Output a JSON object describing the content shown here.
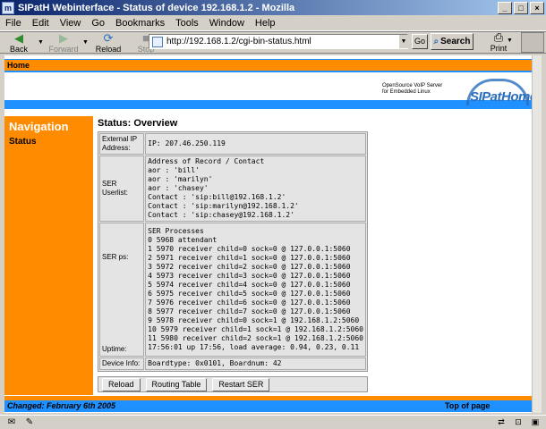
{
  "window": {
    "title": "SIPatH Webinterface - Status of device 192.168.1.2 - Mozilla",
    "icon": "mozilla-icon"
  },
  "menu": [
    "File",
    "Edit",
    "View",
    "Go",
    "Bookmarks",
    "Tools",
    "Window",
    "Help"
  ],
  "toolbar": {
    "back": "Back",
    "forward": "Forward",
    "reload": "Reload",
    "stop": "Stop",
    "url": "http://192.168.1.2/cgi-bin-status.html",
    "go": "Go",
    "search": "Search",
    "print": "Print"
  },
  "page": {
    "home_link": "Home",
    "tagline": [
      "OpenSource VoIP Server",
      "for Embedded Linux"
    ],
    "logo_text": "SIPatHome",
    "nav_title": "Navigation",
    "nav_items": [
      "Status"
    ],
    "heading": "Status: Overview",
    "rows": {
      "external_ip": {
        "label": "External IP Address:",
        "lines": [
          "IP: 207.46.250.119"
        ]
      },
      "ser_userlist": {
        "label": "SER Userlist:",
        "lines": [
          "Address of Record / Contact",
          "aor : 'bill'",
          "aor : 'marilyn'",
          "aor : 'chasey'",
          "Contact : 'sip:bill@192.168.1.2'",
          "Contact : 'sip:marilyn@192.168.1.2'",
          "Contact : 'sip:chasey@192.168.1.2'"
        ]
      },
      "ser_ps": {
        "label": "SER ps:",
        "uptime_label": "Uptime:",
        "lines": [
          "SER Processes",
          "0 5968 attendant",
          "1 5970 receiver child=0 sock=0 @ 127.0.0.1:5060",
          "2 5971 receiver child=1 sock=0 @ 127.0.0.1:5060",
          "3 5972 receiver child=2 sock=0 @ 127.0.0.1:5060",
          "4 5973 receiver child=3 sock=0 @ 127.0.0.1:5060",
          "5 5974 receiver child=4 sock=0 @ 127.0.0.1:5060",
          "6 5975 receiver child=5 sock=0 @ 127.0.0.1:5060",
          "7 5976 receiver child=6 sock=0 @ 127.0.0.1:5060",
          "8 5977 receiver child=7 sock=0 @ 127.0.0.1:5060",
          "9 5978 receiver child=0 sock=1 @ 192.168.1.2:5060",
          "10 5979 receiver child=1 sock=1 @ 192.168.1.2:5060",
          "11 5980 receiver child=2 sock=1 @ 192.168.1.2:5060",
          "17:56:01 up 17:56, load average: 0.94, 0.23, 0.11"
        ]
      },
      "device_info": {
        "label": "Device Info:",
        "lines": [
          "Boardtype: 0x0101, Boardnum: 42"
        ]
      }
    },
    "buttons": {
      "reload": "Reload",
      "routing_table": "Routing Table",
      "restart_ser": "Restart SER"
    },
    "footer_changed": "Changed: February 6th 2005",
    "footer_top": "Top of page"
  }
}
